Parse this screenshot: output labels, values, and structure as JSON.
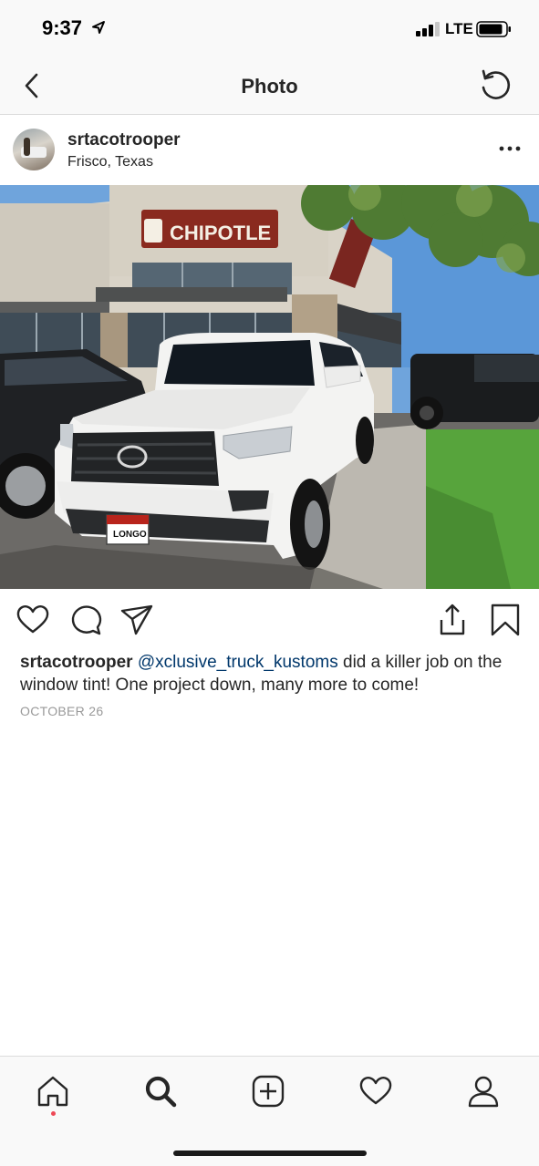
{
  "status_bar": {
    "time": "9:37",
    "network": "LTE"
  },
  "nav": {
    "title": "Photo",
    "back_icon": "chevron-left-icon",
    "refresh_icon": "refresh-icon"
  },
  "post": {
    "username": "srtacotrooper",
    "location": "Frisco, Texas",
    "photo": {
      "sign_text": "CHIPOTLE",
      "plate_text": "LONGO"
    },
    "caption": {
      "username": "srtacotrooper",
      "mention": "@xclusive_truck_kustoms",
      "text": " did a killer job on the window tint! One project down, many more to come!"
    },
    "date": "OCTOBER 26"
  },
  "actions": [
    "heart-icon",
    "comment-icon",
    "send-icon",
    "share-icon",
    "bookmark-icon"
  ],
  "tab_bar": {
    "items": [
      "home-icon",
      "search-icon",
      "add-icon",
      "activity-icon",
      "profile-icon"
    ],
    "active": "search-icon",
    "notification_color": "#ed4956"
  },
  "colors": {
    "text": "#262626",
    "mention": "#00376b",
    "secondary": "#999999",
    "bar_bg": "#f9f9f9"
  }
}
